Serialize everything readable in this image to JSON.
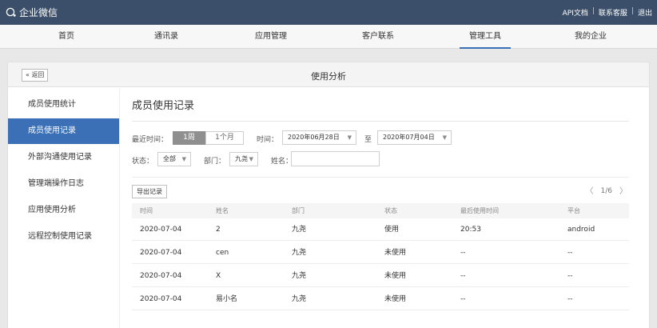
{
  "app": {
    "logo_text": "企业微信"
  },
  "top_links": [
    "API文档",
    "联系客服",
    "退出"
  ],
  "nav": {
    "items": [
      "首页",
      "通讯录",
      "应用管理",
      "客户联系",
      "管理工具",
      "我的企业"
    ],
    "active_index": 4
  },
  "panel": {
    "back_label": "« 返回",
    "title": "使用分析"
  },
  "sidebar": {
    "items": [
      "成员使用统计",
      "成员使用记录",
      "外部沟通使用记录",
      "管理端操作日志",
      "应用使用分析",
      "远程控制使用记录"
    ],
    "active_index": 1
  },
  "content": {
    "title": "成员使用记录",
    "filters": {
      "recent_label": "最近时间：",
      "period_options": [
        "1周",
        "1个月"
      ],
      "period_selected": "1周",
      "time_label": "时间：",
      "date_from": "2020年06月28日",
      "to_label": "至",
      "date_to": "2020年07月04日",
      "status_label": "状态：",
      "status_value": "全部",
      "dept_label": "部门：",
      "dept_value": "九尧",
      "name_label": "姓名：",
      "name_value": ""
    },
    "export_label": "导出记录",
    "pager": {
      "prev": "〈",
      "page_text": "1/6",
      "next": "〉"
    },
    "table": {
      "columns": [
        "时间",
        "姓名",
        "部门",
        "状态",
        "最后使用时间",
        "平台"
      ],
      "rows": [
        [
          "2020-07-04",
          "2",
          "九尧",
          "使用",
          "20:53",
          "android"
        ],
        [
          "2020-07-04",
          "cen",
          "九尧",
          "未使用",
          "--",
          "--"
        ],
        [
          "2020-07-04",
          "X",
          "九尧",
          "未使用",
          "--",
          "--"
        ],
        [
          "2020-07-04",
          "易小名",
          "九尧",
          "未使用",
          "--",
          "--"
        ]
      ]
    }
  },
  "colors": {
    "topbar": "#3b4f6a",
    "accent": "#3b6fb6",
    "segment_on": "#8f8f8f"
  }
}
